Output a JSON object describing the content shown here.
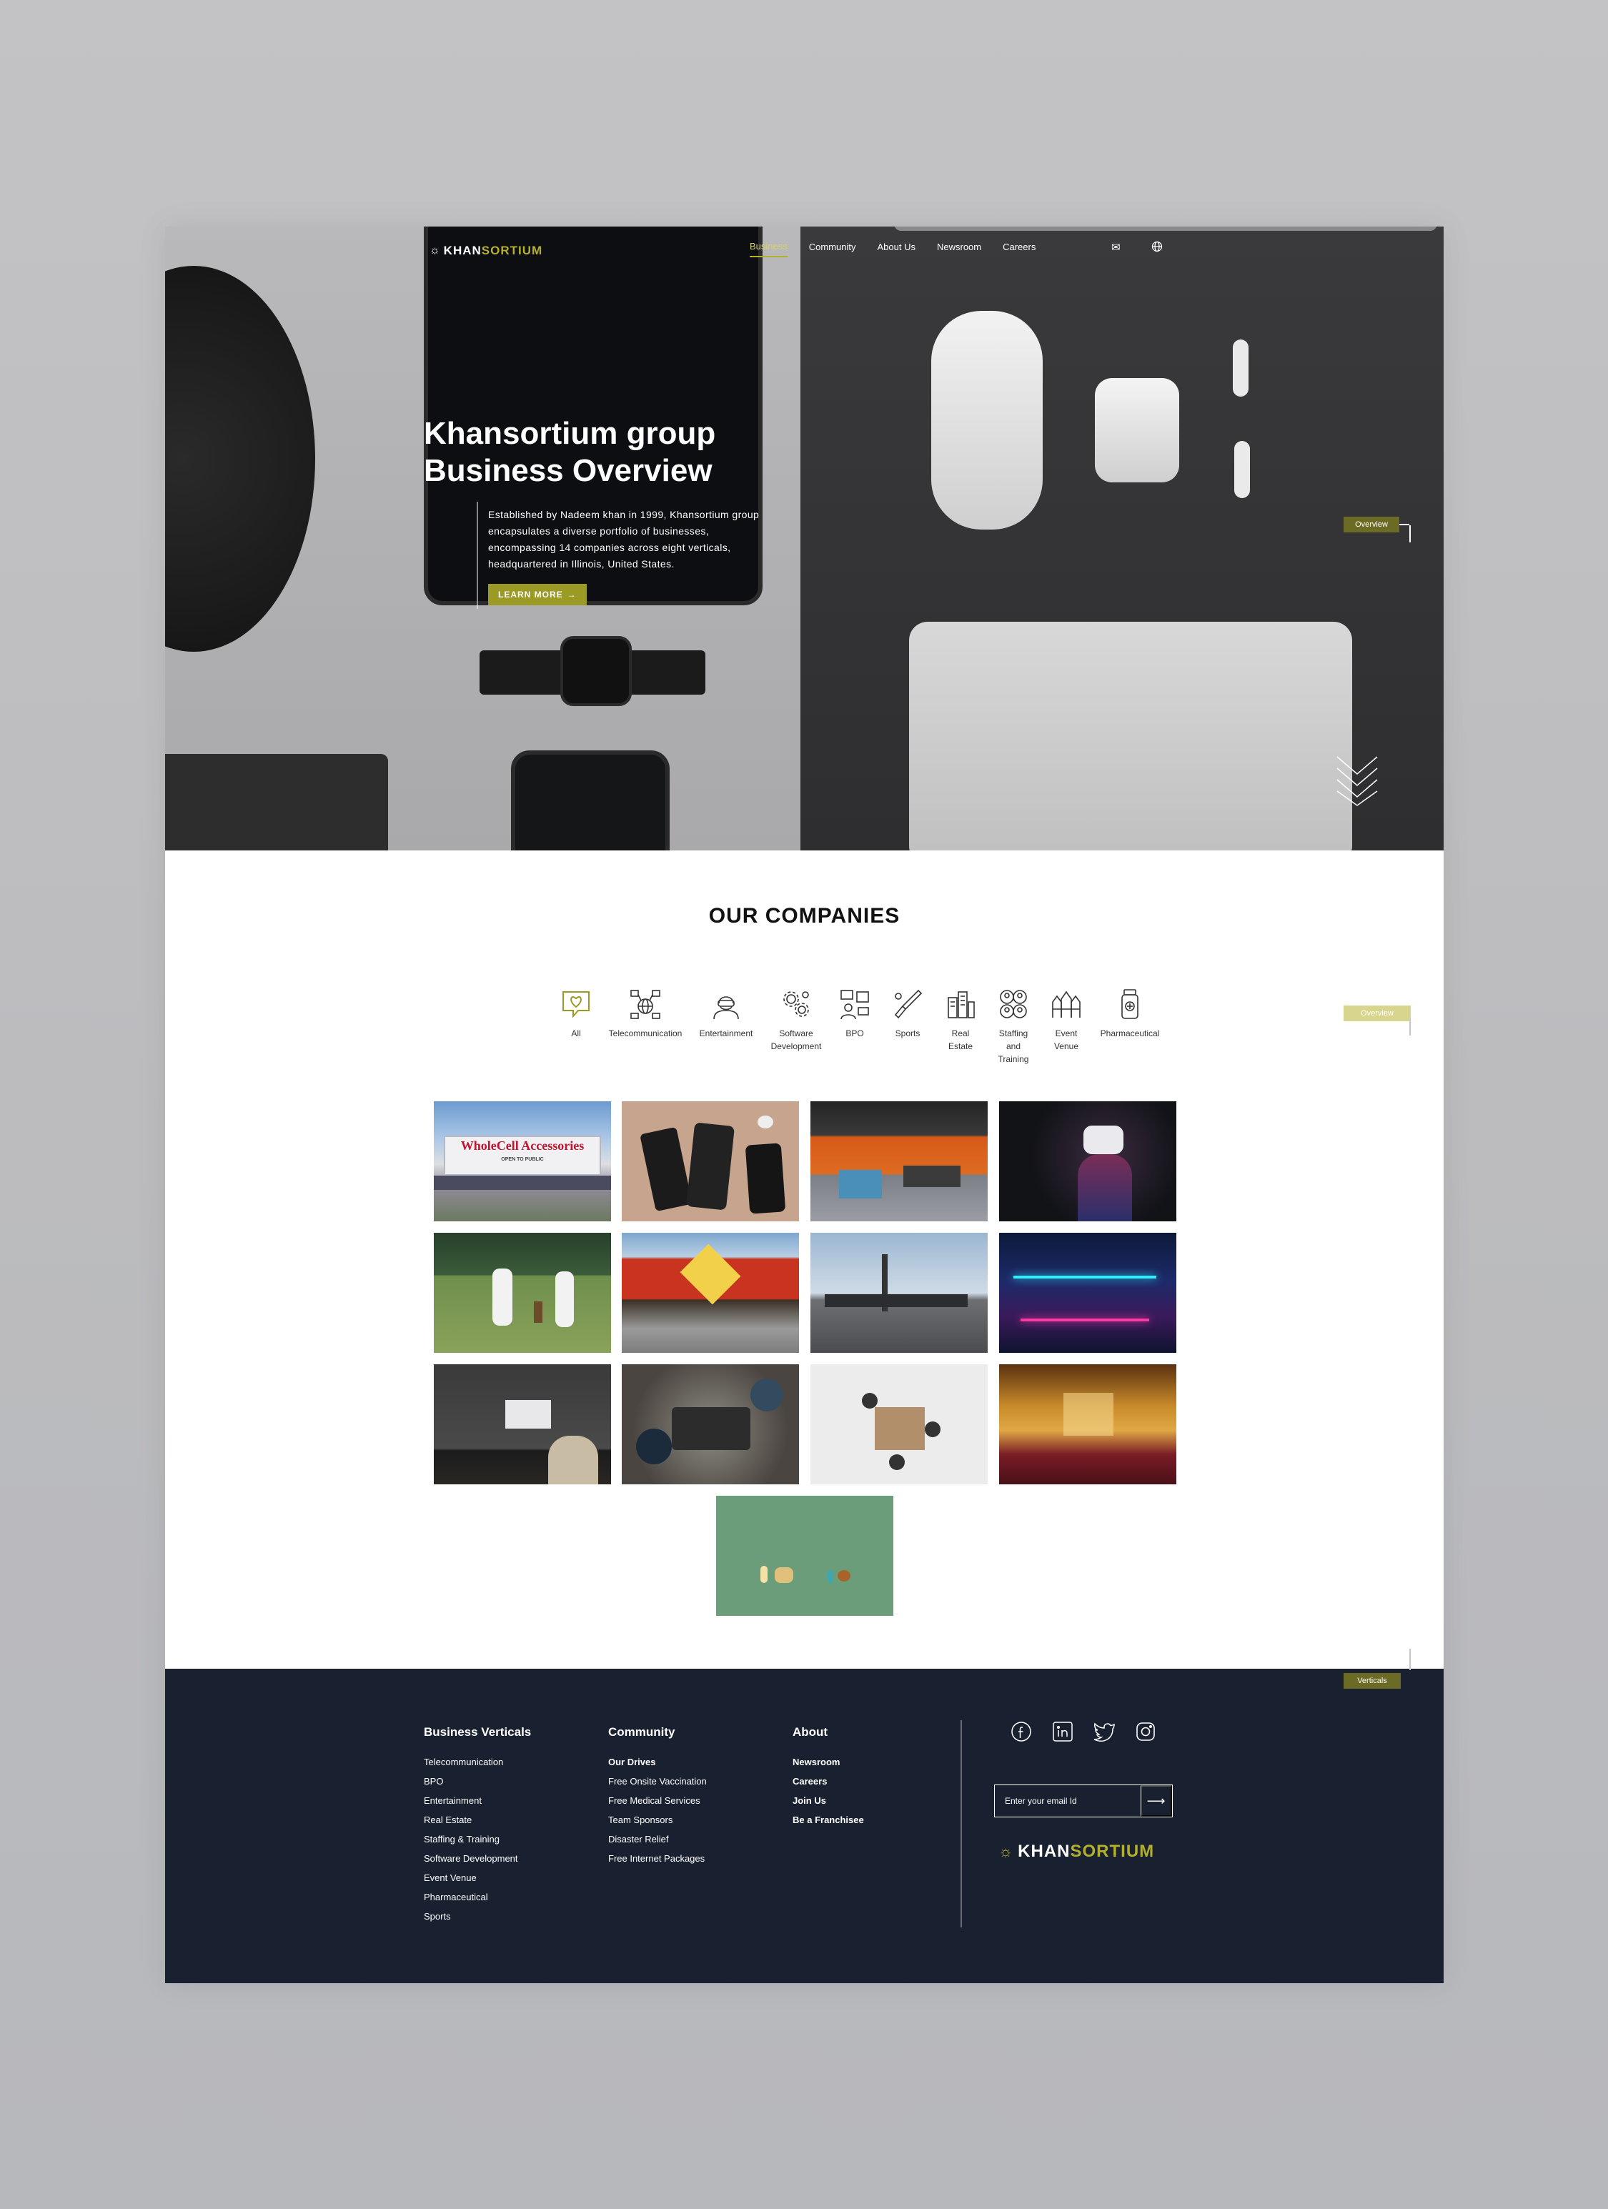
{
  "brand": {
    "logo_part1": "KHAN",
    "logo_part2": "SORTIUM",
    "accent": "#b5b02a",
    "footer_bg": "#192030"
  },
  "nav": {
    "items": [
      {
        "label": "Business",
        "active": true
      },
      {
        "label": "Community",
        "active": false
      },
      {
        "label": "About Us",
        "active": false
      },
      {
        "label": "Newsroom",
        "active": false
      },
      {
        "label": "Careers",
        "active": false
      }
    ],
    "icons": [
      "mail-icon",
      "globe-icon"
    ]
  },
  "hero": {
    "title_line1": "Khansortium group",
    "title_line2": "Business Overview",
    "description": "Established by Nadeem khan in 1999, Khansortium group encapsulates a diverse portfolio of businesses, encompassing 14 companies across eight verticals, headquartered in Illinois, United States.",
    "cta_label": "LEARN MORE",
    "side_tag": "Overview"
  },
  "companies": {
    "title": "OUR COMPANIES",
    "side_tag": "Overview",
    "filters": [
      {
        "label": "All",
        "icon": "heart-chat-icon",
        "active": true
      },
      {
        "label": "Telecommunication",
        "icon": "network-globe-icon",
        "active": false
      },
      {
        "label": "Entertainment",
        "icon": "vr-person-icon",
        "active": false
      },
      {
        "label": "Software Development",
        "icon": "gears-icon",
        "active": false
      },
      {
        "label": "BPO",
        "icon": "bpo-desk-icon",
        "active": false
      },
      {
        "label": "Sports",
        "icon": "cricket-bat-icon",
        "active": false
      },
      {
        "label": "Real Estate",
        "icon": "buildings-icon",
        "active": false
      },
      {
        "label": "Staffing and Training",
        "icon": "team-icon",
        "active": false
      },
      {
        "label": "Event Venue",
        "icon": "venue-icon",
        "active": false
      },
      {
        "label": "Pharmaceutical",
        "icon": "medicine-bottle-icon",
        "active": false
      }
    ],
    "tiles": [
      {
        "name": "wholecell-accessories-storefront",
        "sign_text": "WholeCell Accessories",
        "sign_sub": "OPEN TO PUBLIC"
      },
      {
        "name": "phone-repair-parts"
      },
      {
        "name": "orange-office-interior"
      },
      {
        "name": "vr-headset-person"
      },
      {
        "name": "cricket-match"
      },
      {
        "name": "mid-west-restaurant"
      },
      {
        "name": "street-parking-lot"
      },
      {
        "name": "neon-event-hall"
      },
      {
        "name": "dark-desk-workspace"
      },
      {
        "name": "team-working-laptops"
      },
      {
        "name": "meeting-room-aerial"
      },
      {
        "name": "ornate-ballroom"
      },
      {
        "name": "pills-on-green"
      }
    ]
  },
  "footer": {
    "side_tag": "Verticals",
    "columns": [
      {
        "title": "Business Verticals",
        "items": [
          {
            "label": "Telecommunication",
            "bold": false
          },
          {
            "label": "BPO",
            "bold": false
          },
          {
            "label": "Entertainment",
            "bold": false
          },
          {
            "label": "Real Estate",
            "bold": false
          },
          {
            "label": "Staffing & Training",
            "bold": false
          },
          {
            "label": "Software Development",
            "bold": false
          },
          {
            "label": "Event Venue",
            "bold": false
          },
          {
            "label": "Pharmaceutical",
            "bold": false
          },
          {
            "label": "Sports",
            "bold": false
          }
        ]
      },
      {
        "title": "Community",
        "items": [
          {
            "label": "Our Drives",
            "bold": true
          },
          {
            "label": "Free Onsite Vaccination",
            "bold": false
          },
          {
            "label": "Free Medical Services",
            "bold": false
          },
          {
            "label": "Team Sponsors",
            "bold": false
          },
          {
            "label": "Disaster Relief",
            "bold": false
          },
          {
            "label": "Free Internet Packages",
            "bold": false
          }
        ]
      },
      {
        "title": "About",
        "items": [
          {
            "label": "Newsroom",
            "bold": true
          },
          {
            "label": "Careers",
            "bold": true
          },
          {
            "label": "Join Us",
            "bold": true
          },
          {
            "label": "Be a Franchisee",
            "bold": true
          }
        ]
      }
    ],
    "social": [
      "facebook-icon",
      "linkedin-icon",
      "twitter-icon",
      "instagram-icon"
    ],
    "email_placeholder": "Enter your email Id"
  }
}
